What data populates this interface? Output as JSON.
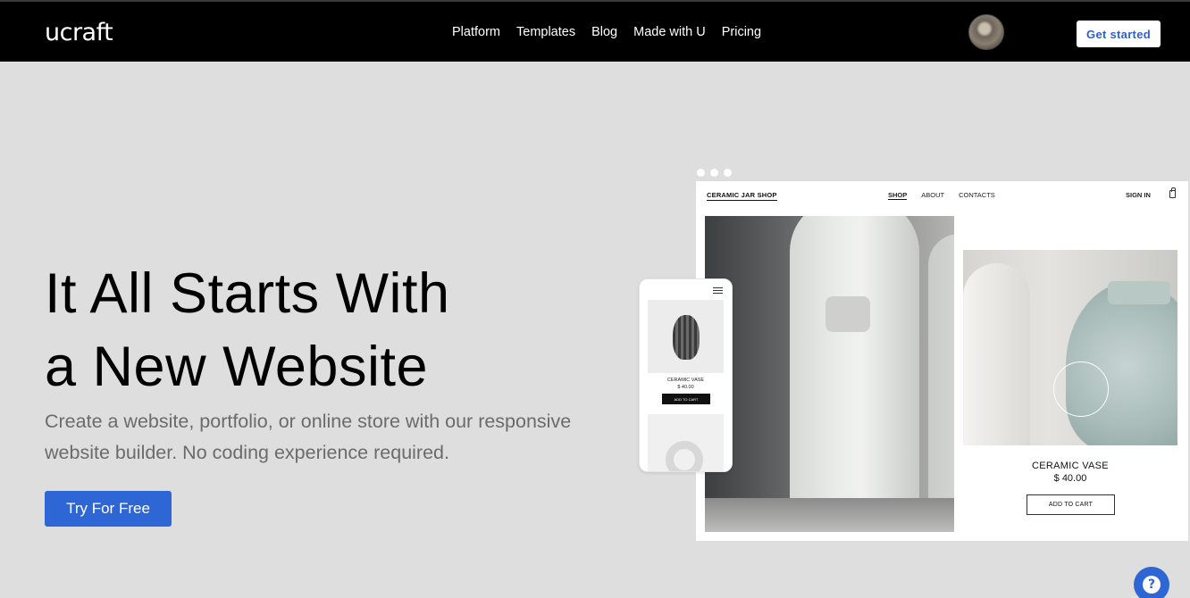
{
  "header": {
    "logo": "ucraft",
    "nav": [
      "Platform",
      "Templates",
      "Blog",
      "Made with U",
      "Pricing"
    ],
    "get_started": "Get started"
  },
  "hero": {
    "title_line1": "It All Starts With",
    "title_line2": "a New Website",
    "subtitle": "Create a website, portfolio, or online store with our responsive website builder. No coding experience required.",
    "cta": "Try For Free"
  },
  "mockup": {
    "brand": "CERAMIC JAR SHOP",
    "nav": [
      "SHOP",
      "ABOUT",
      "CONTACTS"
    ],
    "sign_in": "SIGN IN",
    "product_name": "CERAMIC VASE",
    "product_price": "$ 40.00",
    "add_to_cart": "ADD TO CART"
  },
  "phone": {
    "product_name": "CERAMIC VASE",
    "product_price": "$ 40.00",
    "add_to_cart": "ADD TO CART"
  },
  "help": {
    "icon": "?"
  },
  "colors": {
    "accent": "#2e66d6",
    "topbar": "#000000",
    "background": "#dedede"
  }
}
